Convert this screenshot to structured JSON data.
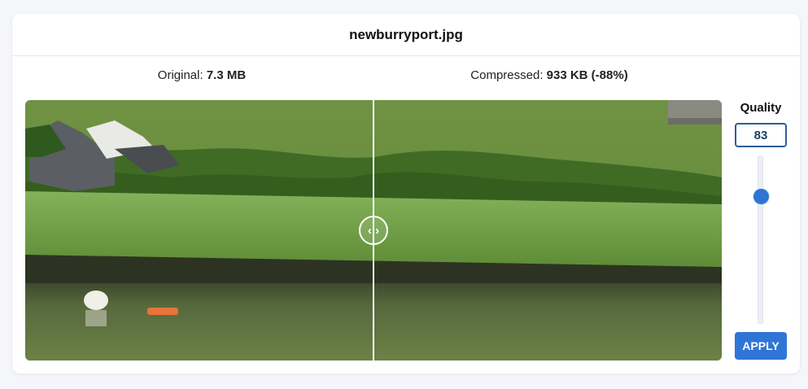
{
  "header": {
    "filename": "newburryport.jpg"
  },
  "labels": {
    "original_prefix": "Original: ",
    "original_size": "7.3 MB",
    "compressed_prefix": "Compressed: ",
    "compressed_size": "933 KB (-88%)"
  },
  "compare": {
    "split_fraction": 0.5,
    "handle_icon": "left-right-arrows-icon",
    "handle_glyph": "‹ ›"
  },
  "quality": {
    "title": "Quality",
    "value": "83",
    "slider_level": 0.22,
    "thumb_glyph": "⌃⌄"
  },
  "apply_label": "APPLY",
  "colors": {
    "accent": "#2f75d6",
    "input_border": "#2c5d99",
    "grass": "#6b9a3f",
    "water": "#5b6f43"
  }
}
